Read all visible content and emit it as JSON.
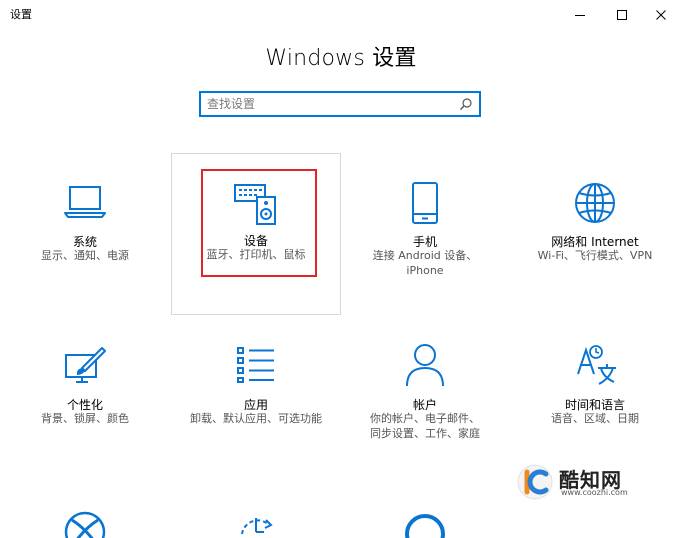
{
  "window": {
    "title": "设置",
    "minimize_label": "最小化",
    "maximize_label": "最大化",
    "close_label": "关闭"
  },
  "page": {
    "title": "Windows 设置"
  },
  "search": {
    "placeholder": "查找设置",
    "value": ""
  },
  "tiles": [
    {
      "name": "系统",
      "desc": "显示、通知、电源",
      "icon": "laptop-icon"
    },
    {
      "name": "设备",
      "desc": "蓝牙、打印机、鼠标",
      "icon": "devices-icon",
      "selected": true
    },
    {
      "name": "手机",
      "desc": "连接 Android 设备、iPhone",
      "icon": "phone-icon"
    },
    {
      "name": "网络和 Internet",
      "desc": "Wi-Fi、飞行模式、VPN",
      "icon": "globe-icon"
    },
    {
      "name": "个性化",
      "desc": "背景、锁屏、颜色",
      "icon": "paint-icon"
    },
    {
      "name": "应用",
      "desc": "卸载、默认应用、可选功能",
      "icon": "apps-list-icon"
    },
    {
      "name": "帐户",
      "desc": "你的帐户、电子邮件、同步设置、工作、家庭",
      "icon": "person-icon"
    },
    {
      "name": "时间和语言",
      "desc": "语音、区域、日期",
      "icon": "language-icon"
    },
    {
      "name": "",
      "desc": "",
      "icon": "xbox-icon"
    },
    {
      "name": "",
      "desc": "",
      "icon": "clock-refresh-icon"
    },
    {
      "name": "",
      "desc": "",
      "icon": "cortana-icon"
    }
  ],
  "watermark": {
    "text": "酷知网",
    "url": "www.coozhi.com",
    "icon": "coozhi-logo-icon"
  },
  "colors": {
    "accent": "#0078d7",
    "highlight": "#e0252b",
    "tile_border": "#d6d6d6"
  }
}
